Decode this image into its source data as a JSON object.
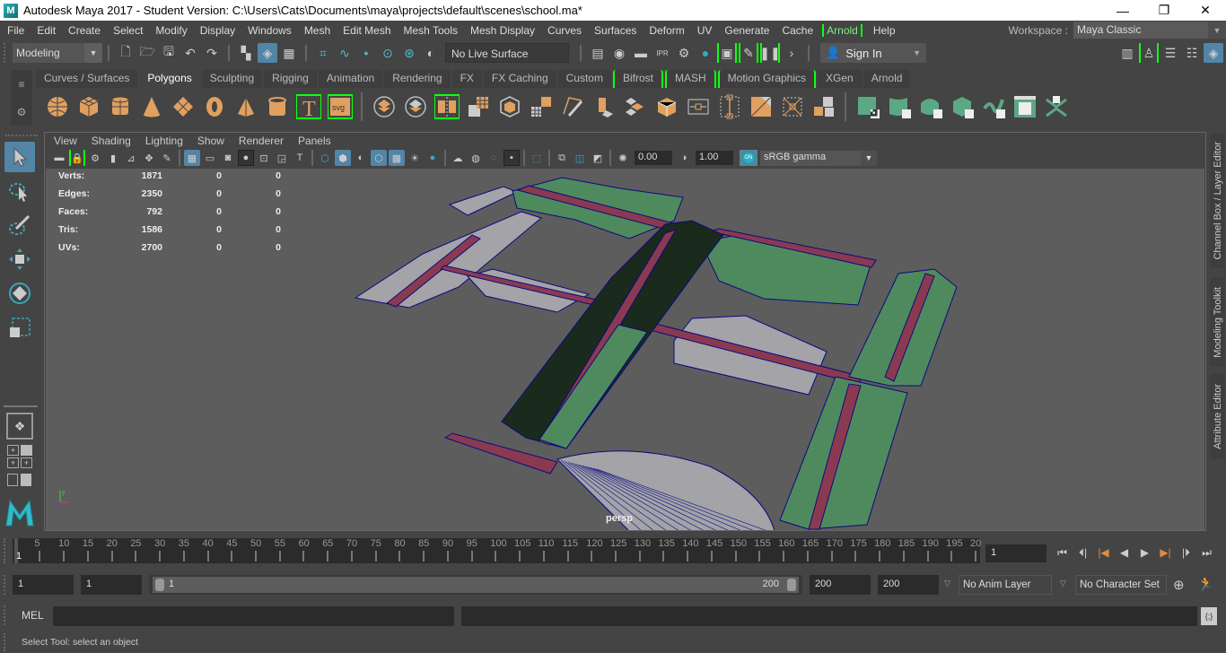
{
  "window": {
    "app_icon": "maya-logo-icon",
    "title": "Autodesk Maya 2017 - Student Version: C:\\Users\\Cats\\Documents\\maya\\projects\\default\\scenes\\school.ma*",
    "controls": {
      "minimize": "—",
      "maximize": "❐",
      "close": "✕"
    }
  },
  "menubar": {
    "items": [
      "File",
      "Edit",
      "Create",
      "Select",
      "Modify",
      "Display",
      "Windows",
      "Mesh",
      "Edit Mesh",
      "Mesh Tools",
      "Mesh Display",
      "Curves",
      "Surfaces",
      "Deform",
      "UV",
      "Generate",
      "Cache",
      "Arnold",
      "Help"
    ],
    "workspace_label": "Workspace :",
    "workspace_value": "Maya Classic"
  },
  "statusline": {
    "mode": "Modeling",
    "live_surface": "No Live Surface",
    "sign_in": "Sign In"
  },
  "shelf": {
    "tabs": [
      "Curves / Surfaces",
      "Polygons",
      "Sculpting",
      "Rigging",
      "Animation",
      "Rendering",
      "FX",
      "FX Caching",
      "Custom",
      "Bifrost",
      "MASH",
      "Motion Graphics",
      "XGen",
      "Arnold"
    ],
    "active_tab": "Polygons",
    "colors": {
      "orange": "#e0a060",
      "green": "#5ca884",
      "highlight": "#22ff22"
    }
  },
  "panel": {
    "menu": [
      "View",
      "Shading",
      "Lighting",
      "Show",
      "Renderer",
      "Panels"
    ],
    "exposure": "0.00",
    "gamma": "1.00",
    "color_management_on": "ON",
    "view_transform": "sRGB gamma",
    "camera": "persp"
  },
  "hud": {
    "rows": [
      {
        "label": "Verts:",
        "v1": "1871",
        "v2": "0",
        "v3": "0"
      },
      {
        "label": "Edges:",
        "v1": "2350",
        "v2": "0",
        "v3": "0"
      },
      {
        "label": "Faces:",
        "v1": "792",
        "v2": "0",
        "v3": "0"
      },
      {
        "label": "Tris:",
        "v1": "1586",
        "v2": "0",
        "v3": "0"
      },
      {
        "label": "UVs:",
        "v1": "2700",
        "v2": "0",
        "v3": "0"
      }
    ]
  },
  "right_dock": {
    "tabs": [
      "Channel Box / Layer Editor",
      "Modeling Toolkit",
      "Attribute Editor"
    ]
  },
  "timeslider": {
    "ticks": [
      "5",
      "10",
      "15",
      "20",
      "25",
      "30",
      "35",
      "40",
      "45",
      "50",
      "55",
      "60",
      "65",
      "70",
      "75",
      "80",
      "85",
      "90",
      "95",
      "100",
      "105",
      "110",
      "115",
      "120",
      "125",
      "130",
      "135",
      "140",
      "145",
      "150",
      "155",
      "160",
      "165",
      "170",
      "175",
      "180",
      "185",
      "190",
      "195",
      "20"
    ],
    "current_frame_marker": "1",
    "current_frame": "1",
    "range_start": 1,
    "range_end": 200
  },
  "rangebar": {
    "start_time": "1",
    "playback_start": "1",
    "slider_start": "1",
    "slider_end": "200",
    "playback_end": "200",
    "end_time": "200",
    "anim_layer": "No Anim Layer",
    "character_set": "No Character Set"
  },
  "commandline": {
    "language": "MEL",
    "input": "",
    "result": ""
  },
  "helpline": {
    "text": "Select Tool: select an object"
  },
  "scene_colors": {
    "background": "#5d5d5d",
    "floor_gray": "#a3a3a8",
    "room_green": "#4f8a5e",
    "room_dark": "#1a2a1c",
    "corridor": "#8a3a50",
    "wire": "#0a0a80"
  }
}
